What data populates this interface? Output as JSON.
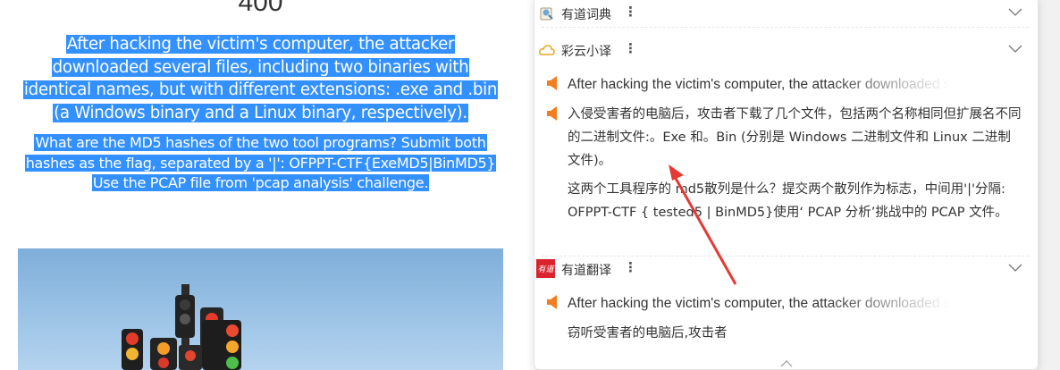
{
  "challenge": {
    "points": "400",
    "description_p1": "After hacking the victim's computer, the attacker downloaded several files, including two binaries with identical names, but with different extensions: .exe and .bin (a Windows binary and a Linux binary, respectively).",
    "description_p2": "What are the MD5 hashes of the two tool programs? Submit both hashes as the flag, separated by a '|': OFPPT-CTF{ExeMD5|BinMD5} Use the PCAP file from 'pcap analysis' challenge."
  },
  "popup": {
    "sections": [
      {
        "name": "有道词典",
        "icon": "dictionary-icon"
      },
      {
        "name": "彩云小译",
        "icon": "cloud-icon"
      },
      {
        "name": "有道翻译",
        "icon": "youdao-logo-icon",
        "logo_text": "有道"
      }
    ],
    "caiyun": {
      "source": "After hacking the victim's computer, the attacker downloaded s",
      "translation_p1": "入侵受害者的电脑后，攻击者下载了几个文件，包括两个名称相同但扩展名不同的二进制文件:。Exe 和。Bin (分别是 Windows 二进制文件和 Linux 二进制文件)。",
      "translation_p2": "这两个工具程序的 md5散列是什么？提交两个散列作为标志，中间用'|'分隔: OFPPT-CTF { tested5 | BinMD5}使用‘ PCAP 分析’挑战中的 PCAP 文件。"
    },
    "youdao": {
      "source": "After hacking the victim's computer, the attacker downloaded s",
      "translation": "窃听受害者的电脑后,攻击者"
    }
  },
  "colors": {
    "selection": "#3390ff",
    "speaker": "#f57c1f",
    "annotation_arrow": "#e53935",
    "youdao_logo": "#d9232d"
  }
}
